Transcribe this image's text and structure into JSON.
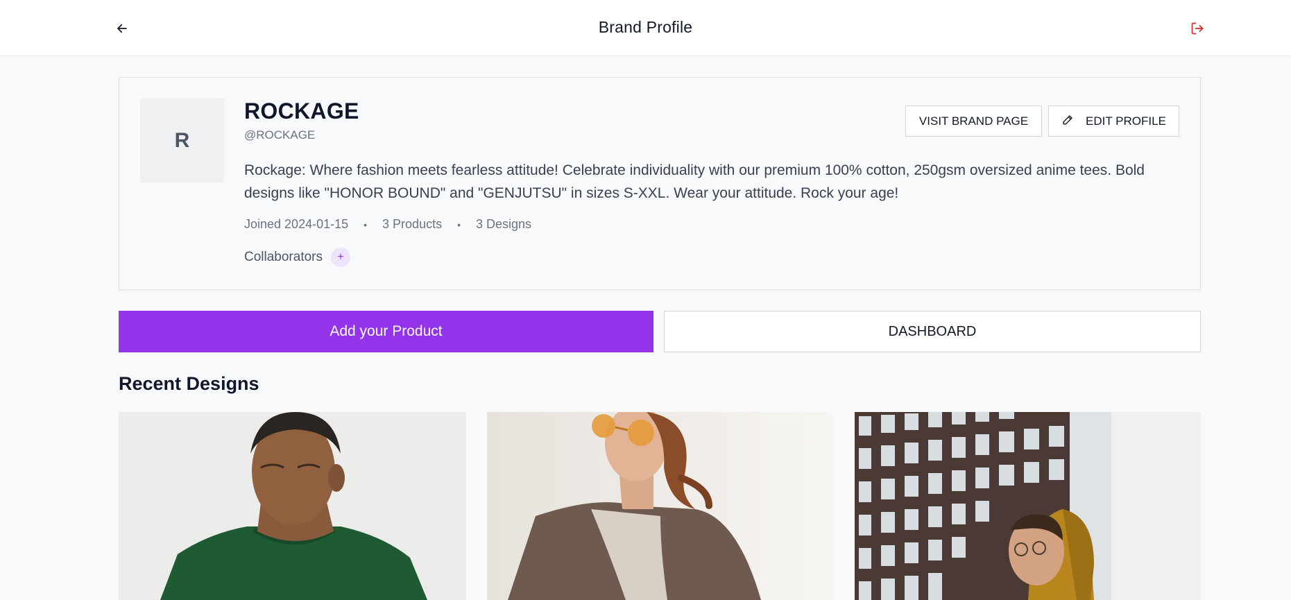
{
  "header": {
    "title": "Brand Profile",
    "back_icon": "arrow-left-icon",
    "logout_icon": "logout-icon",
    "logout_color": "#dc2626"
  },
  "brand": {
    "avatar_initial": "R",
    "name": "ROCKAGE",
    "handle": "@ROCKAGE",
    "bio": "Rockage: Where fashion meets fearless attitude! Celebrate individuality with our premium 100% cotton, 250gsm oversized anime tees. Bold designs like \"HONOR BOUND\" and \"GENJUTSU\" in sizes S-XXL. Wear your attitude. Rock your age!",
    "meta": {
      "joined": "Joined 2024-01-15",
      "products": "3 Products",
      "designs": "3 Designs",
      "separator": "•"
    },
    "collaborators_label": "Collaborators",
    "collaborators_add": "+"
  },
  "actions": {
    "visit_label": "VISIT BRAND PAGE",
    "edit_label": "EDIT PROFILE",
    "edit_icon": "pencil-icon",
    "add_product_label": "Add your Product",
    "dashboard_label": "DASHBOARD",
    "accent_color": "#9333ea"
  },
  "recent_designs": {
    "title": "Recent Designs",
    "items": [
      {
        "image": "man-green-tshirt-photo"
      },
      {
        "image": "woman-orange-sunglasses-photo"
      },
      {
        "image": "man-yellow-hoodie-building-photo"
      }
    ]
  }
}
